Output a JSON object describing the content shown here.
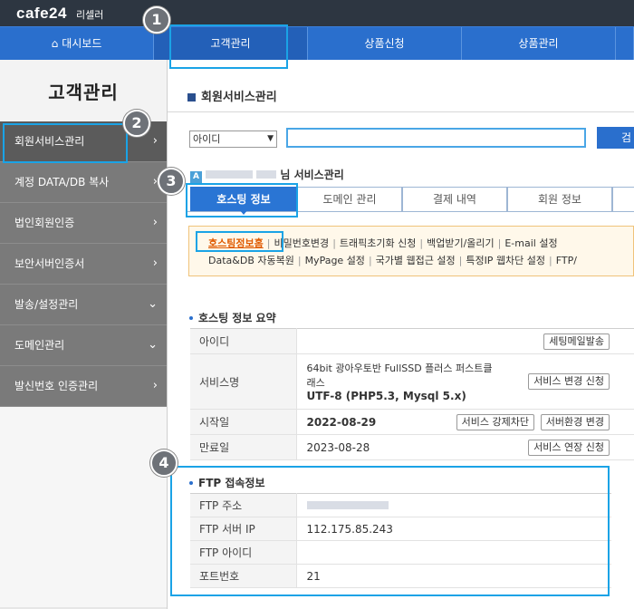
{
  "brand": {
    "logo": "cafe24",
    "sub": "리셀러"
  },
  "nav": {
    "home": "대시보드",
    "customer": "고객관리",
    "order": "상품신청",
    "products": "상품관리"
  },
  "sidebar": {
    "title": "고객관리",
    "items": [
      {
        "label": "회원서비스관리",
        "arrow": "›"
      },
      {
        "label": "계정 DATA/DB 복사",
        "arrow": "›"
      },
      {
        "label": "법인회원인증",
        "arrow": "›"
      },
      {
        "label": "보안서버인증서",
        "arrow": "›"
      },
      {
        "label": "발송/설정관리",
        "arrow": "⌄"
      },
      {
        "label": "도메인관리",
        "arrow": "⌄"
      },
      {
        "label": "발신번호 인증관리",
        "arrow": "›"
      }
    ]
  },
  "page": {
    "title": "회원서비스관리"
  },
  "search": {
    "select_value": "아이디",
    "button": "검"
  },
  "member": {
    "badge": "A",
    "suffix": "님 서비스관리"
  },
  "tabs": [
    "호스팅 정보",
    "도메인 관리",
    "결제 내역",
    "회원 정보"
  ],
  "submenu": {
    "row1": [
      "호스팅정보홈",
      "비밀번호변경",
      "트래픽초기화 신청",
      "백업받기/올리기",
      "E-mail 설정"
    ],
    "row2": [
      "Data&DB 자동복원",
      "MyPage 설정",
      "국가별 웹접근 설정",
      "특정IP 웹차단 설정",
      "FTP/"
    ]
  },
  "summary": {
    "heading": "호스팅 정보 요약",
    "rows": {
      "id_label": "아이디",
      "id_btn": "세팅메일발송",
      "service_label": "서비스명",
      "service_line1": "64bit 광아우토반 FullSSD 플러스 퍼스트클",
      "service_line2": "래스",
      "service_line3": "UTF-8 (PHP5.3, Mysql 5.x)",
      "service_btn": "서비스 변경 신청",
      "start_label": "시작일",
      "start_value": "2022-08-29",
      "start_btn1": "서비스 강제차단",
      "start_btn2": "서버환경 변경",
      "end_label": "만료일",
      "end_value": "2023-08-28",
      "end_btn": "서비스 연장 신청"
    }
  },
  "ftp": {
    "heading": "FTP 접속정보",
    "rows": [
      {
        "label": "FTP 주소",
        "value": ""
      },
      {
        "label": "FTP 서버 IP",
        "value": "112.175.85.243"
      },
      {
        "label": "FTP 아이디",
        "value": ""
      },
      {
        "label": "포트번호",
        "value": "21"
      }
    ]
  },
  "steps": [
    "1",
    "2",
    "3",
    "4"
  ],
  "colors": {
    "nav": "#2a6fcd",
    "highlight": "#1aa3e6",
    "active_tab": "#2a75d4",
    "current_link": "#e05a00"
  }
}
